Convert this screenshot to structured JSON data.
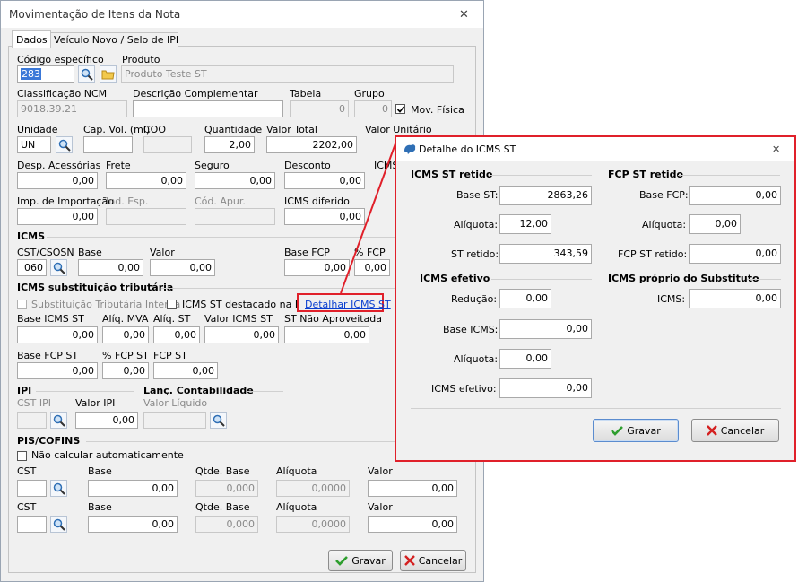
{
  "main": {
    "title": "Movimentação de Itens da Nota",
    "close_glyph": "✕",
    "tabs": [
      "Dados",
      "Veículo Novo / Selo de IPI"
    ],
    "fields": {
      "codigo_label": "Código específico",
      "codigo_value": "283",
      "produto_label": "Produto",
      "produto_value": "Produto Teste ST",
      "ncm_label": "Classificação NCM",
      "ncm_value": "9018.39.21",
      "desc_label": "Descrição Complementar",
      "tabela_label": "Tabela",
      "tabela_value": "0",
      "grupo_label": "Grupo",
      "grupo_value": "0",
      "movfisica_label": "Mov. Física",
      "unidade_label": "Unidade",
      "unidade_value": "UN",
      "capvol_label": "Cap. Vol. (ml)",
      "coo_label": "COO",
      "qtd_label": "Quantidade",
      "qtd_value": "2,00",
      "valortotal_label": "Valor Total",
      "valortotal_value": "2202,00",
      "valorunit_label": "Valor Unitário",
      "desp_label": "Desp. Acessórias",
      "desp_value": "0,00",
      "frete_label": "Frete",
      "frete_value": "0,00",
      "seguro_label": "Seguro",
      "seguro_value": "0,00",
      "desconto_label": "Desconto",
      "desconto_value": "0,00",
      "icms_cut_label": "ICMS",
      "impimp_label": "Imp. de Importação",
      "impimp_value": "0,00",
      "indesp_label": "Ind. Esp.",
      "codapur_label": "Cód. Apur.",
      "icmsdif_label": "ICMS diferido",
      "icmsdif_value": "0,00"
    },
    "icms": {
      "heading": "ICMS",
      "cst_label": "CST/CSOSN",
      "cst_value": "060",
      "base_label": "Base",
      "base_value": "0,00",
      "valor_label": "Valor",
      "valor_value": "0,00",
      "basefcp_label": "Base FCP",
      "basefcp_value": "0,00",
      "pfcp_label": "% FCP",
      "pfcp_value": "0,00"
    },
    "st": {
      "heading": "ICMS substituição tributária",
      "interna_label": "Substituição Tributária Interna",
      "destacado_label": "ICMS ST destacado na NF",
      "detalhar_link": "Detalhar ICMS ST",
      "baseicmsst_label": "Base ICMS ST",
      "baseicmsst_value": "0,00",
      "aliqmva_label": "Alíq. MVA",
      "aliqmva_value": "0,00",
      "aliqst_label": "Alíq. ST",
      "aliqst_value": "0,00",
      "valoricmsst_label": "Valor ICMS ST",
      "valoricmsst_value": "0,00",
      "stnaoaprov_label": "ST Não Aproveitada",
      "stnaoaprov_value": "0,00",
      "basefcpst_label": "Base FCP ST",
      "basefcpst_value": "0,00",
      "pfcpst_label": "% FCP ST",
      "pfcpst_value": "0,00",
      "fcpst_label": "FCP ST",
      "fcpst_value": "0,00"
    },
    "ipi": {
      "heading": "IPI",
      "cst_label": "CST IPI",
      "valor_label": "Valor IPI",
      "valor_value": "0,00"
    },
    "lanc": {
      "heading": "Lanç. Contabilidade",
      "valor_label": "Valor Líquido"
    },
    "pis": {
      "heading": "PIS/COFINS",
      "naocalc_label": "Não calcular automaticamente",
      "rows": [
        {
          "cst_label": "CST",
          "base_label": "Base",
          "base_value": "0,00",
          "qtde_label": "Qtde. Base",
          "qtde_value": "0,000",
          "aliq_label": "Alíquota",
          "aliq_value": "0,0000",
          "valor_label": "Valor",
          "valor_value": "0,00"
        },
        {
          "cst_label": "CST",
          "base_label": "Base",
          "base_value": "0,00",
          "qtde_label": "Qtde. Base",
          "qtde_value": "0,000",
          "aliq_label": "Alíquota",
          "aliq_value": "0,0000",
          "valor_label": "Valor",
          "valor_value": "0,00"
        }
      ]
    },
    "buttons": {
      "gravar": "Gravar",
      "cancelar": "Cancelar"
    }
  },
  "dialog": {
    "title": "Detalhe do ICMS ST",
    "close_glyph": "✕",
    "st_retido": {
      "heading": "ICMS ST retido",
      "base_label": "Base ST:",
      "base_value": "2863,26",
      "aliq_label": "Alíquota:",
      "aliq_value": "12,00",
      "retido_label": "ST retido:",
      "retido_value": "343,59"
    },
    "fcp_retido": {
      "heading": "FCP ST retido",
      "base_label": "Base FCP:",
      "base_value": "0,00",
      "aliq_label": "Alíquota:",
      "aliq_value": "0,00",
      "retido_label": "FCP ST retido:",
      "retido_value": "0,00"
    },
    "efetivo": {
      "heading": "ICMS efetivo",
      "reducao_label": "Redução:",
      "reducao_value": "0,00",
      "base_label": "Base ICMS:",
      "base_value": "0,00",
      "aliq_label": "Alíquota:",
      "aliq_value": "0,00",
      "efetivo_label": "ICMS efetivo:",
      "efetivo_value": "0,00"
    },
    "proprio": {
      "heading": "ICMS próprio do Substituto",
      "icms_label": "ICMS:",
      "icms_value": "0,00"
    },
    "buttons": {
      "gravar": "Gravar",
      "cancelar": "Cancelar"
    }
  },
  "colors": {
    "highlight": "#e0202a",
    "link": "#0a3fd0",
    "selection": "#3a78d8",
    "ok_green": "#2e9e2e",
    "cancel_red": "#d42020"
  },
  "icons": [
    "search-icon",
    "folder-icon",
    "check-icon",
    "x-icon",
    "app-icon",
    "close-icon"
  ]
}
